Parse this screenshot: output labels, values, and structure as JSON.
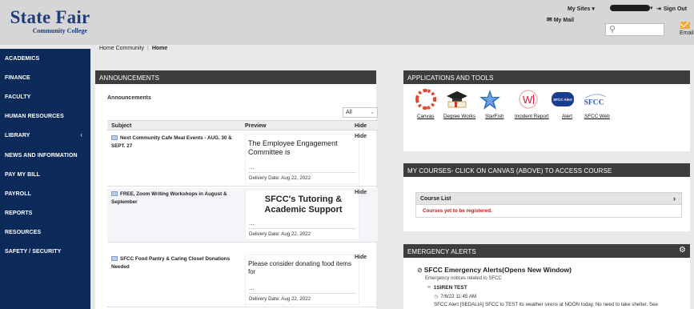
{
  "header": {
    "logo_line1": "State Fair",
    "logo_line2": "Community College",
    "my_mail": "My Mail",
    "my_sites": "My Sites",
    "sign_out": "Sign Out",
    "email_label": "Email",
    "search_placeholder": "",
    "colors": {
      "header_bg": "#d6d6d6",
      "brand_blue": "#1f3d7a"
    }
  },
  "sidebar": {
    "color": "#0b2a5a",
    "items": [
      {
        "label": "ACADEMICS"
      },
      {
        "label": "FINANCE"
      },
      {
        "label": "FACULTY"
      },
      {
        "label": "HUMAN RESOURCES"
      },
      {
        "label": "LIBRARY",
        "chevron": "‹"
      },
      {
        "label": "NEWS AND INFORMATION"
      },
      {
        "label": "PAY MY BILL"
      },
      {
        "label": "PAYROLL"
      },
      {
        "label": "REPORTS"
      },
      {
        "label": "RESOURCES"
      },
      {
        "label": "SAFETY / SECURITY"
      }
    ]
  },
  "breadcrumb": {
    "parent": "Home Community",
    "current": "Home"
  },
  "announcements": {
    "title": "ANNOUNCEMENTS",
    "subtitle": "Announcements",
    "filter_value": "All",
    "columns": {
      "subject": "Subject",
      "preview": "Preview",
      "hide": "Hide"
    },
    "rows": [
      {
        "subject": "Next Community Cafe Meal Events - AUG. 30 & SEPT. 27",
        "preview": "The Employee Engagement Committee is",
        "dots": "...",
        "date": "Delivery Date: Aug 22, 2022",
        "hide": "Hide"
      },
      {
        "subject": "FREE, Zoom Writing Workshops in August & September",
        "preview": "SFCC's Tutoring & Academic Support",
        "dots": "...",
        "date": "Delivery Date: Aug 22, 2022",
        "hide": "Hide"
      },
      {
        "subject": "SFCC Food Pantry & Caring Closet Donations Needed",
        "preview": "Please consider donating food items for",
        "dots": "...",
        "date": "Delivery Date: Aug 22, 2022",
        "hide": "Hide"
      }
    ]
  },
  "apps": {
    "title": "APPLICATIONS AND TOOLS",
    "items": [
      {
        "label": "Canvas",
        "icon": "canvas-icon"
      },
      {
        "label": "Degree Works",
        "icon": "degree-works-icon"
      },
      {
        "label": "StarFish",
        "icon": "starfish-icon"
      },
      {
        "label": "Incident Report",
        "icon": "incident-report-icon"
      },
      {
        "label": "Alert",
        "icon": "alert-icon",
        "badge": "SFCC Alert"
      },
      {
        "label": "SFCC Web",
        "icon": "sfcc-web-icon",
        "badge": "SFCC"
      }
    ]
  },
  "courses": {
    "title": "MY COURSES- CLICK ON CANVAS (ABOVE) TO ACCESS COURSE",
    "list_label": "Course List",
    "chevron": "›",
    "message": "Courses yet to be registered."
  },
  "alerts": {
    "title": "EMERGENCY ALERTS",
    "link": "SFCC Emergency Alerts(Opens New Window)",
    "subtitle": "Emergency notices related to SFCC",
    "item": "1SIREN TEST",
    "time": "7/6/22 11:45 AM",
    "body": "SFCC Alert [SEDALIA] SFCC to TEST its weather sirens at NOON today. No need to take shelter. See"
  }
}
